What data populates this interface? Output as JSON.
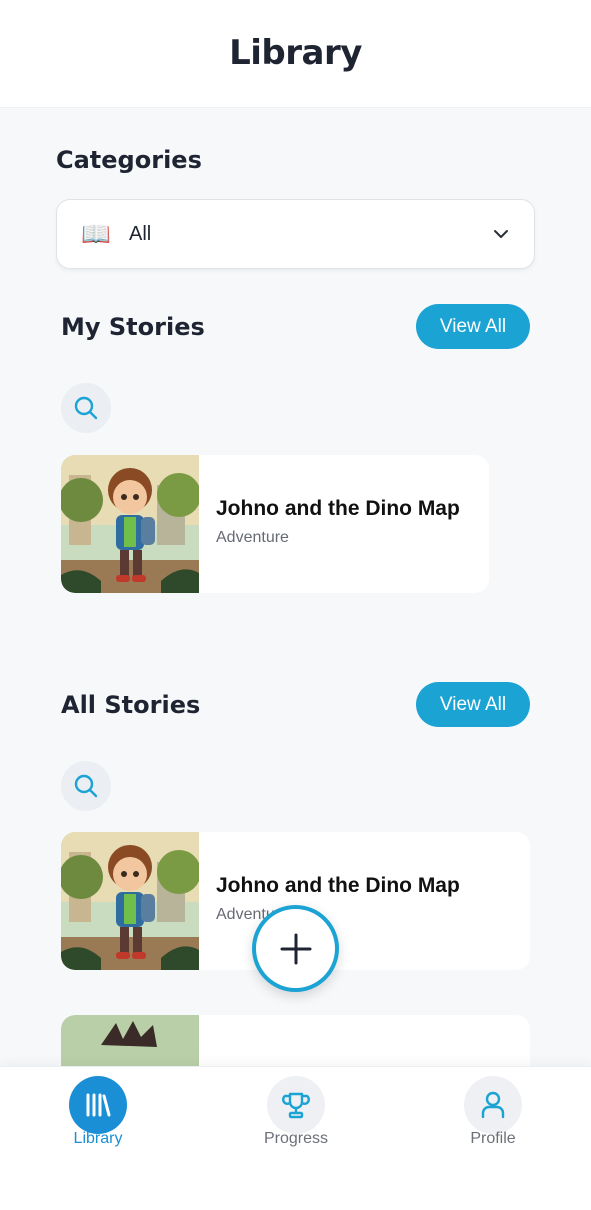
{
  "header": {
    "title": "Library"
  },
  "categories": {
    "title": "Categories",
    "selected": "All",
    "icon": "open-book-icon"
  },
  "my_stories": {
    "title": "My Stories",
    "view_all": "View All",
    "items": [
      {
        "title": "Johno and the Dino Map",
        "genre": "Adventure"
      }
    ]
  },
  "all_stories": {
    "title": "All Stories",
    "view_all": "View All",
    "items": [
      {
        "title": "Johno and the Dino Map",
        "genre": "Adventure"
      }
    ]
  },
  "nav": {
    "items": [
      {
        "label": "Library",
        "icon": "library-icon",
        "active": true
      },
      {
        "label": "Progress",
        "icon": "trophy-icon",
        "active": false
      },
      {
        "label": "Profile",
        "icon": "user-icon",
        "active": false
      }
    ]
  },
  "colors": {
    "accent": "#1ba3d4",
    "nav_active": "#1b8fd6",
    "background": "#f6f8fa"
  }
}
